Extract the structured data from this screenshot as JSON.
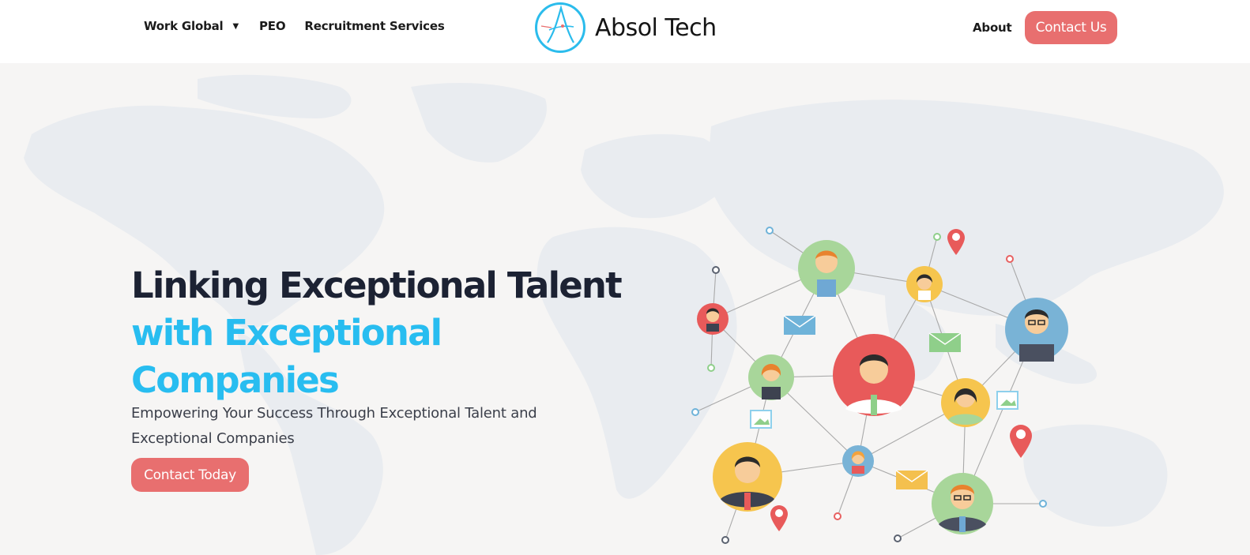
{
  "header": {
    "nav": {
      "work_global": "Work Global",
      "peo": "PEO",
      "recruitment": "Recruitment Services",
      "about": "About"
    },
    "logo_text": "Absol Tech",
    "contact_us": "Contact Us"
  },
  "hero": {
    "headline_dark": "Linking Exceptional Talent",
    "headline_accent": "with Exceptional Companies",
    "subtext": "Empowering Your Success Through Exceptional Talent and Exceptional Companies",
    "cta": "Contact Today"
  },
  "colors": {
    "accent_blue": "#28bdf0",
    "button_coral": "#e86f6f",
    "dark_text": "#1c2233",
    "hero_bg": "#f6f5f4"
  },
  "icons": [
    "caret-down-icon",
    "absol-tech-logo-icon"
  ]
}
